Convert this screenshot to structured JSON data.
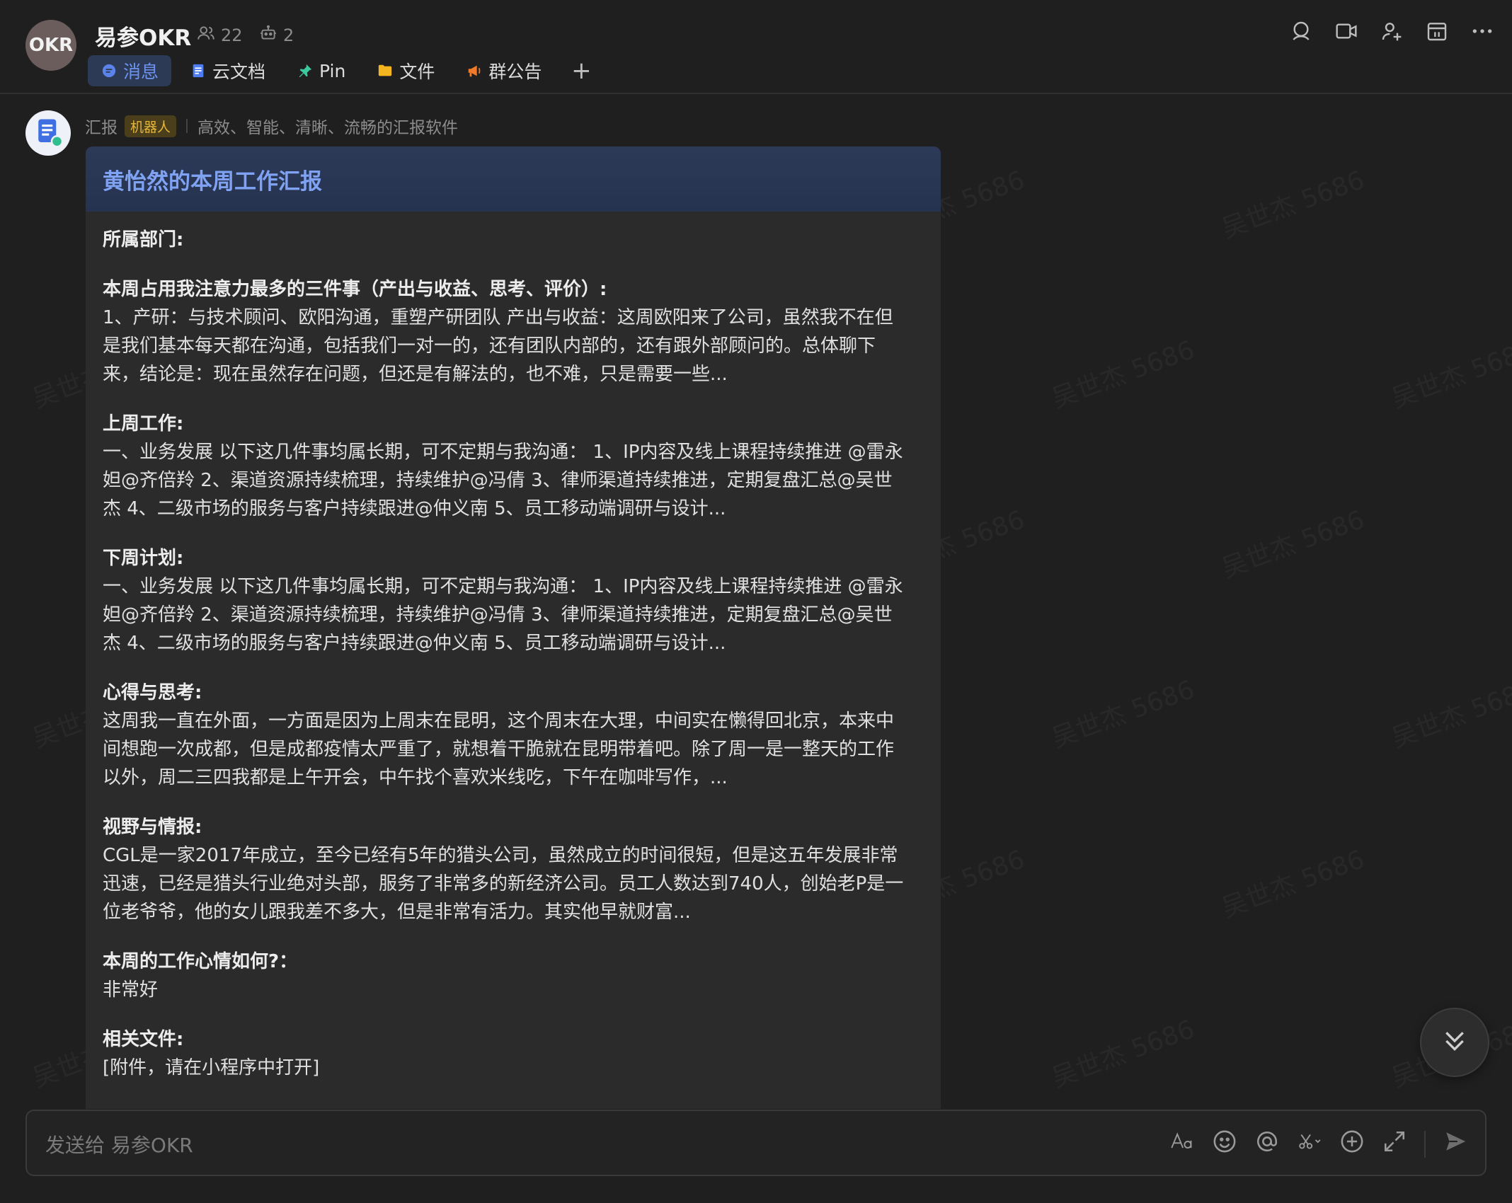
{
  "header": {
    "avatar_text": "OKR",
    "title": "易参OKR",
    "member_count": "22",
    "bot_count": "2"
  },
  "tabs": [
    {
      "label": "消息",
      "icon": "chat-bubble-icon"
    },
    {
      "label": "云文档",
      "icon": "doc-icon"
    },
    {
      "label": "Pin",
      "icon": "pin-icon"
    },
    {
      "label": "文件",
      "icon": "folder-icon"
    },
    {
      "label": "群公告",
      "icon": "megaphone-icon"
    }
  ],
  "message": {
    "sender": "汇报",
    "badge": "机器人",
    "sender_desc": "高效、智能、清晰、流畅的汇报软件",
    "card_title": "黄怡然的本周工作汇报",
    "sections": [
      {
        "label": "所属部门:",
        "content": ""
      },
      {
        "label": "本周占用我注意力最多的三件事（产出与收益、思考、评价）:",
        "content": "1、产研：与技术顾问、欧阳沟通，重塑产研团队 产出与收益：这周欧阳来了公司，虽然我不在但是我们基本每天都在沟通，包括我们一对一的，还有团队内部的，还有跟外部顾问的。总体聊下来，结论是：现在虽然存在问题，但还是有解法的，也不难，只是需要一些..."
      },
      {
        "label": "上周工作:",
        "content": "一、业务发展 以下这几件事均属长期，可不定期与我沟通： 1、IP内容及线上课程持续推进 @雷永妲@齐倍羚 2、渠道资源持续梳理，持续维护@冯倩 3、律师渠道持续推进，定期复盘汇总@吴世杰 4、二级市场的服务与客户持续跟进@仲义南 5、员工移动端调研与设计..."
      },
      {
        "label": "下周计划:",
        "content": "一、业务发展 以下这几件事均属长期，可不定期与我沟通： 1、IP内容及线上课程持续推进 @雷永妲@齐倍羚 2、渠道资源持续梳理，持续维护@冯倩 3、律师渠道持续推进，定期复盘汇总@吴世杰 4、二级市场的服务与客户持续跟进@仲义南 5、员工移动端调研与设计..."
      },
      {
        "label": "心得与思考:",
        "content": "这周我一直在外面，一方面是因为上周末在昆明，这个周末在大理，中间实在懒得回北京，本来中间想跑一次成都，但是成都疫情太严重了，就想着干脆就在昆明带着吧。除了周一是一整天的工作以外，周二三四我都是上午开会，中午找个喜欢米线吃，下午在咖啡写作，..."
      },
      {
        "label": "视野与情报:",
        "content": "CGL是一家2017年成立，至今已经有5年的猎头公司，虽然成立的时间很短，但是这五年发展非常迅速，已经是猎头行业绝对头部，服务了非常多的新经济公司。员工人数达到740人，创始老P是一位老爷爷，他的女儿跟我差不多大，但是非常有活力。其实他早就财富..."
      },
      {
        "label": "本周的工作心情如何?：",
        "content": "非常好"
      },
      {
        "label": "相关文件:",
        "content": "[附件，请在小程序中打开]"
      }
    ]
  },
  "composer": {
    "placeholder": "发送给 易参OKR"
  },
  "watermark_text": "吴世杰 5686"
}
